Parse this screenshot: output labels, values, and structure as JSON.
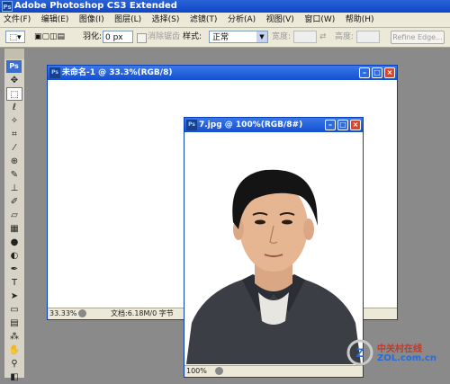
{
  "app": {
    "title": "Adobe Photoshop CS3 Extended",
    "logo": "Ps"
  },
  "menu": [
    "文件(F)",
    "编辑(E)",
    "图像(I)",
    "图层(L)",
    "选择(S)",
    "滤镜(T)",
    "分析(A)",
    "视图(V)",
    "窗口(W)",
    "帮助(H)"
  ],
  "options": {
    "feather_label": "羽化:",
    "feather_value": "0 px",
    "antialias_label": "消除锯齿",
    "style_label": "样式:",
    "style_value": "正常",
    "width_label": "宽度:",
    "height_label": "高度:",
    "refine_label": "Refine Edge..."
  },
  "toolbox": {
    "logo": "Ps"
  },
  "doc1": {
    "title": "未命名-1 @ 33.3%(RGB/8)",
    "zoom": "33.33%",
    "status": "文档:6.18M/0 字节"
  },
  "doc2": {
    "title": "7.jpg @ 100%(RGB/8#)",
    "zoom": "100%"
  },
  "watermark": {
    "brand_cn": "中关村在线",
    "brand_en": "ZOL.com.cn"
  },
  "colors": {
    "title_blue": "#1450d0",
    "chrome": "#ece9d8",
    "canvas": "#ffffff",
    "workspace": "#8a8a8a",
    "close_red": "#d8472a"
  }
}
